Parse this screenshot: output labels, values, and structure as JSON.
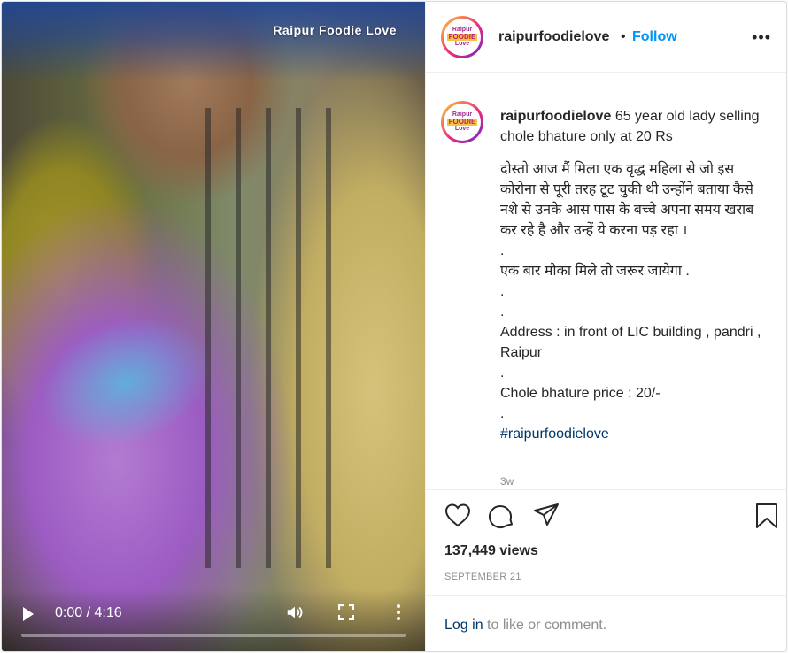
{
  "video": {
    "watermark": "Raipur  Foodie Love",
    "time": "0:00 / 4:16",
    "progress_fraction": 0
  },
  "header": {
    "username": "raipurfoodielove",
    "dot": "•",
    "follow_label": "Follow",
    "more": "•••",
    "logo_top": "Raipur",
    "logo_mid": "FOODIE",
    "logo_bot": "Love"
  },
  "caption": {
    "username": "raipurfoodielove",
    "title": "65 year old lady selling chole bhature only at 20 Rs",
    "hindi_1": "दोस्तो आज मैं मिला एक वृद्ध महिला से जो इस कोरोना से पूरी तरह टूट चुकी थी उन्होंने बताया कैसे नशे से उनके आस पास के बच्चे अपना समय खराब कर रहे है और उन्हें ये करना पड़ रहा ।",
    "dot1": ".",
    "hindi_2": "एक बार मौका मिले तो जरूर जायेगा .",
    "dot2": ".",
    "dot3": ".",
    "address": "Address : in front of LIC building , pandri , Raipur",
    "dot4": ".",
    "price": "Chole bhature price : 20/-",
    "dot5": ".",
    "hashtag": "#raipurfoodielove",
    "ago": "3w"
  },
  "stats": {
    "views": "137,449 views",
    "date": "SEPTEMBER 21"
  },
  "login": {
    "link": "Log in",
    "rest": " to like or comment."
  }
}
